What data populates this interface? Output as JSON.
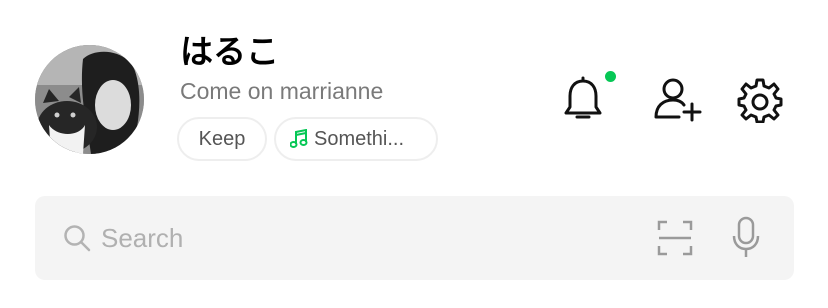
{
  "profile": {
    "name": "はるこ",
    "status_message": "Come on marrianne",
    "avatar_icon": "profile-photo"
  },
  "chips": {
    "keep_label": "Keep",
    "music_label": "Somethi...",
    "music_icon": "music-note-icon",
    "music_icon_color": "#06c755"
  },
  "header_actions": {
    "notifications_icon": "bell-icon",
    "notification_dot_color": "#06c755",
    "add_friend_icon": "add-friend-icon",
    "settings_icon": "gear-icon"
  },
  "search": {
    "placeholder": "Search",
    "search_icon": "search-icon",
    "scan_icon": "qr-scan-icon",
    "voice_icon": "microphone-icon"
  }
}
